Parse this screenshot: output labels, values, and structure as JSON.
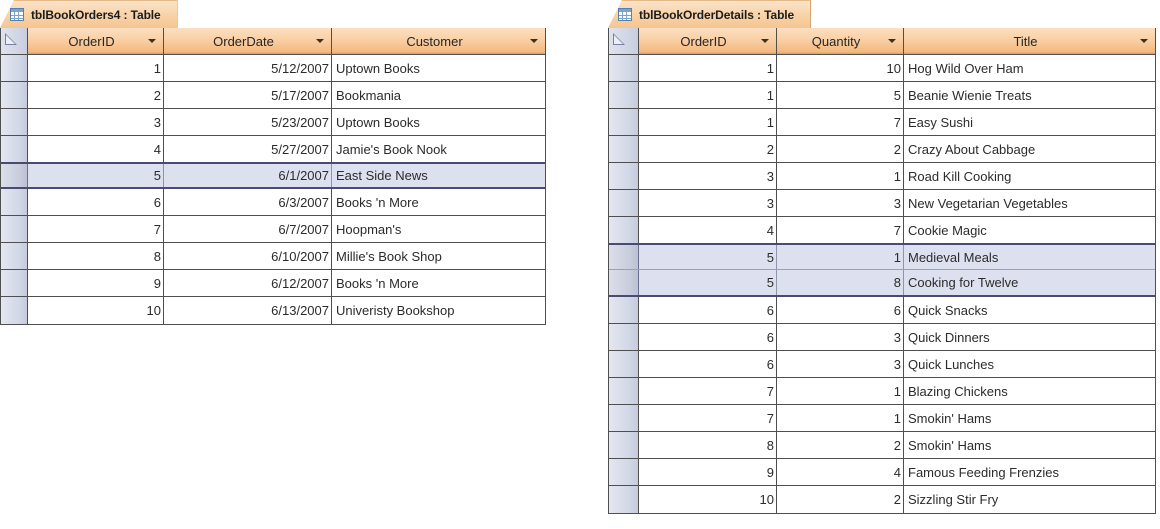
{
  "tables": [
    {
      "id": "left",
      "tab_title": "tblBookOrders4 : Table",
      "tab_icon": "table-icon",
      "select_all_name": "select-all-corner",
      "columns": [
        {
          "label": "OrderID",
          "align": "num"
        },
        {
          "label": "OrderDate",
          "align": "num"
        },
        {
          "label": "Customer",
          "align": "txt"
        }
      ],
      "rows": [
        {
          "cells": [
            "1",
            "5/12/2007",
            "Uptown Books"
          ],
          "selected": false
        },
        {
          "cells": [
            "2",
            "5/17/2007",
            "Bookmania"
          ],
          "selected": false
        },
        {
          "cells": [
            "3",
            "5/23/2007",
            "Uptown Books"
          ],
          "selected": false
        },
        {
          "cells": [
            "4",
            "5/27/2007",
            "Jamie's Book Nook"
          ],
          "selected": false
        },
        {
          "cells": [
            "5",
            "6/1/2007",
            "East Side News"
          ],
          "selected": true
        },
        {
          "cells": [
            "6",
            "6/3/2007",
            "Books 'n More"
          ],
          "selected": false
        },
        {
          "cells": [
            "7",
            "6/7/2007",
            "Hoopman's"
          ],
          "selected": false
        },
        {
          "cells": [
            "8",
            "6/10/2007",
            "Millie's Book Shop"
          ],
          "selected": false
        },
        {
          "cells": [
            "9",
            "6/12/2007",
            "Books 'n More"
          ],
          "selected": false
        },
        {
          "cells": [
            "10",
            "6/13/2007",
            "Univeristy Bookshop"
          ],
          "selected": false
        }
      ]
    },
    {
      "id": "right",
      "tab_title": "tblBookOrderDetails : Table",
      "tab_icon": "table-icon",
      "select_all_name": "select-all-corner",
      "columns": [
        {
          "label": "OrderID",
          "align": "num"
        },
        {
          "label": "Quantity",
          "align": "num"
        },
        {
          "label": "Title",
          "align": "txt"
        }
      ],
      "rows": [
        {
          "cells": [
            "1",
            "10",
            "Hog Wild Over Ham"
          ],
          "selected": false
        },
        {
          "cells": [
            "1",
            "5",
            "Beanie Wienie Treats"
          ],
          "selected": false
        },
        {
          "cells": [
            "1",
            "7",
            "Easy Sushi"
          ],
          "selected": false
        },
        {
          "cells": [
            "2",
            "2",
            "Crazy About Cabbage"
          ],
          "selected": false
        },
        {
          "cells": [
            "3",
            "1",
            "Road Kill Cooking"
          ],
          "selected": false
        },
        {
          "cells": [
            "3",
            "3",
            "New Vegetarian Vegetables"
          ],
          "selected": false
        },
        {
          "cells": [
            "4",
            "7",
            "Cookie Magic"
          ],
          "selected": false
        },
        {
          "cells": [
            "5",
            "1",
            "Medieval Meals"
          ],
          "selected": true
        },
        {
          "cells": [
            "5",
            "8",
            "Cooking for Twelve"
          ],
          "selected": true
        },
        {
          "cells": [
            "6",
            "6",
            "Quick Snacks"
          ],
          "selected": false
        },
        {
          "cells": [
            "6",
            "3",
            "Quick Dinners"
          ],
          "selected": false
        },
        {
          "cells": [
            "6",
            "3",
            "Quick Lunches"
          ],
          "selected": false
        },
        {
          "cells": [
            "7",
            "1",
            "Blazing Chickens"
          ],
          "selected": false
        },
        {
          "cells": [
            "7",
            "1",
            "Smokin' Hams"
          ],
          "selected": false
        },
        {
          "cells": [
            "8",
            "2",
            "Smokin' Hams"
          ],
          "selected": false
        },
        {
          "cells": [
            "9",
            "4",
            "Famous Feeding Frenzies"
          ],
          "selected": false
        },
        {
          "cells": [
            "10",
            "2",
            "Sizzling Stir Fry"
          ],
          "selected": false
        }
      ]
    }
  ],
  "colors": {
    "header_orange": "#f9d0a4",
    "tab_orange": "#f8d4ab",
    "gridline": "#4f4f4f",
    "selection_fill": "#dde1ef",
    "selection_border": "#4a4a72",
    "row_selector": "#d2d7e6",
    "text": "#2b2b2b"
  }
}
